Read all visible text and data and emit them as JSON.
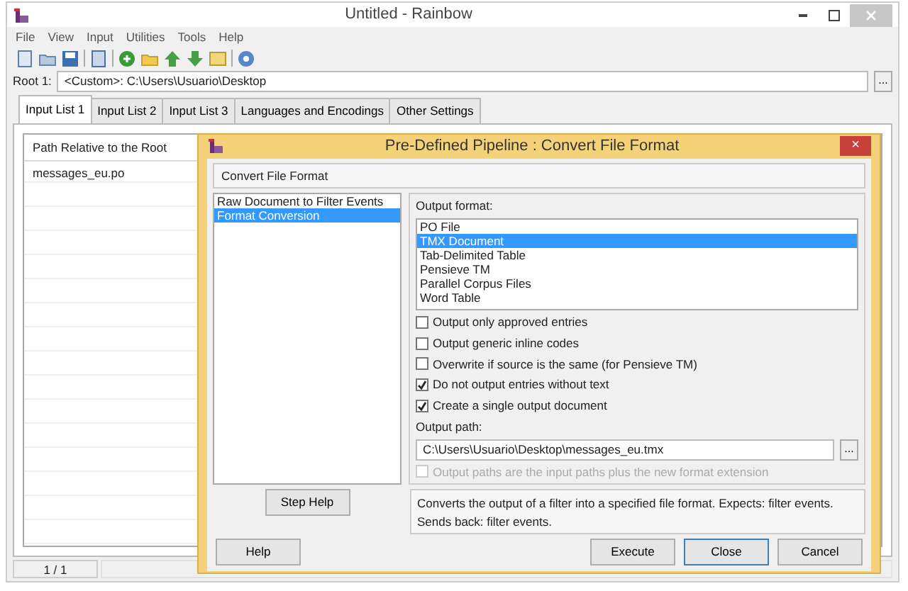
{
  "window": {
    "title": "Untitled - Rainbow"
  },
  "menu": [
    "File",
    "View",
    "Input",
    "Utilities",
    "Tools",
    "Help"
  ],
  "root": {
    "label": "Root 1:",
    "value": "<Custom>:  C:\\Users\\Usuario\\Desktop",
    "browse": "..."
  },
  "tabs": [
    {
      "label": "Input List 1",
      "selected": true
    },
    {
      "label": "Input List 2",
      "selected": false
    },
    {
      "label": "Input List 3",
      "selected": false
    },
    {
      "label": "Languages and Encodings",
      "selected": false
    },
    {
      "label": "Other Settings",
      "selected": false
    }
  ],
  "file_list": {
    "column": "Path Relative to the Root",
    "rows": [
      "messages_eu.po"
    ]
  },
  "status_bar": {
    "count": "1 / 1"
  },
  "dialog": {
    "title": "Pre-Defined Pipeline : Convert File Format",
    "close": "×",
    "section": "Convert File Format",
    "steps": [
      {
        "label": "Raw Document to Filter Events",
        "selected": false
      },
      {
        "label": "Format Conversion",
        "selected": true
      }
    ],
    "output_format_label": "Output format:",
    "formats": [
      {
        "label": "PO File",
        "selected": false
      },
      {
        "label": "TMX Document",
        "selected": true
      },
      {
        "label": "Tab-Delimited Table",
        "selected": false
      },
      {
        "label": "Pensieve TM",
        "selected": false
      },
      {
        "label": "Parallel Corpus Files",
        "selected": false
      },
      {
        "label": "Word Table",
        "selected": false
      }
    ],
    "options": [
      {
        "label": "Output only approved entries",
        "checked": false,
        "disabled": false
      },
      {
        "label": "Output generic inline codes",
        "checked": false,
        "disabled": false
      },
      {
        "label": "Overwrite if source is the same (for Pensieve TM)",
        "checked": false,
        "disabled": false
      },
      {
        "label": "Do not output entries without text",
        "checked": true,
        "disabled": false
      },
      {
        "label": "Create a single output document",
        "checked": true,
        "disabled": false
      }
    ],
    "output_path_label": "Output path:",
    "output_path": "C:\\Users\\Usuario\\Desktop\\messages_eu.tmx",
    "output_path_browse": "...",
    "extension_option": {
      "label": "Output paths are the input paths plus the new format extension",
      "checked": false,
      "disabled": true
    },
    "step_help": "Step Help",
    "description": "Converts the output of a filter into a specified file format. Expects: filter events. Sends back: filter events.",
    "buttons": [
      {
        "label": "Help",
        "kind": "left"
      },
      {
        "label": "Execute",
        "kind": "right"
      },
      {
        "label": "Close",
        "kind": "default"
      },
      {
        "label": "Cancel",
        "kind": "right"
      }
    ]
  }
}
